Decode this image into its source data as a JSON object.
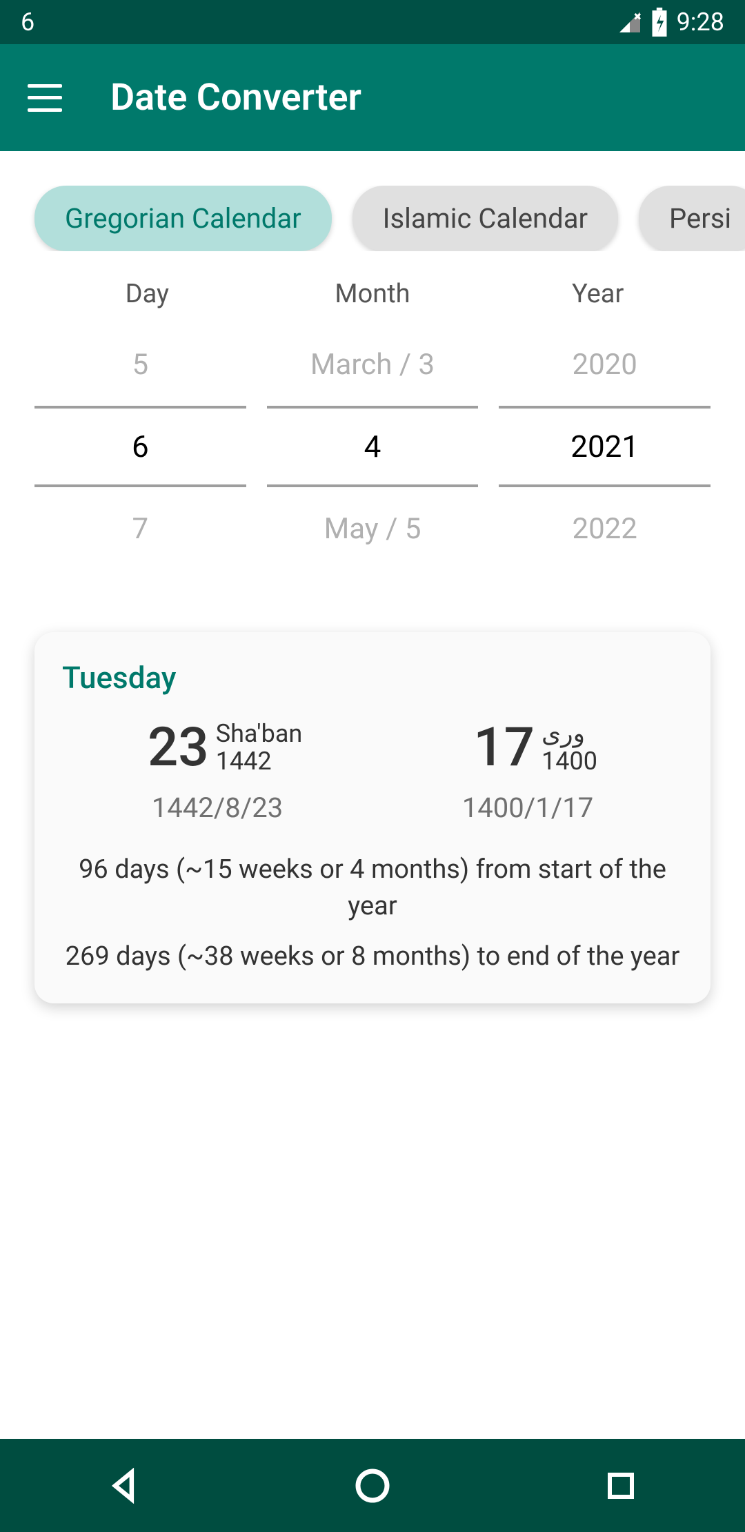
{
  "status": {
    "notifCount": "6",
    "time": "9:28"
  },
  "header": {
    "title": "Date Converter"
  },
  "tabs": [
    {
      "label": "Gregorian Calendar",
      "active": true
    },
    {
      "label": "Islamic Calendar",
      "active": false
    },
    {
      "label": "Persi",
      "active": false
    }
  ],
  "picker": {
    "headers": {
      "day": "Day",
      "month": "Month",
      "year": "Year"
    },
    "day": {
      "prev": "5",
      "cur": "6",
      "next": "7"
    },
    "month": {
      "prev": "March / 3",
      "cur": "4",
      "next": "May / 5"
    },
    "year": {
      "prev": "2020",
      "cur": "2021",
      "next": "2022"
    }
  },
  "result": {
    "weekday": "Tuesday",
    "islamic": {
      "day": "23",
      "month": "Sha'ban",
      "year": "1442",
      "full": "1442/8/23"
    },
    "persian": {
      "day": "17",
      "month": "وری",
      "year": "1400",
      "full": "1400/1/17"
    },
    "fromStart": "96 days (~15 weeks or 4 months) from start of the year",
    "toEnd": "269 days (~38 weeks or 8 months) to end of the year"
  }
}
